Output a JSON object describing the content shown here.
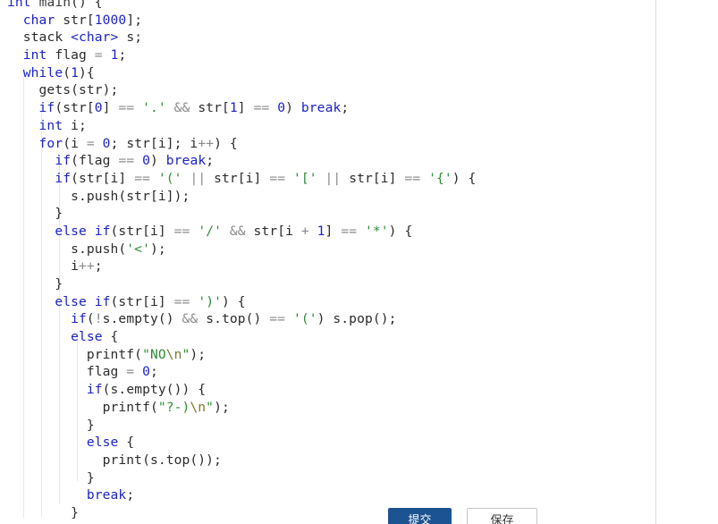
{
  "editor": {
    "language": "cpp",
    "background": "#ffffff",
    "keyword_color": "#1c22c8",
    "string_color": "#2e8b36",
    "operator_color": "#8a8a8a",
    "text_color": "#2b2b2b",
    "guide_color": "#e8e8e8",
    "lines": [
      [
        {
          "t": "int",
          "c": "kw"
        },
        {
          "t": " ",
          "c": "plain"
        },
        {
          "t": "main",
          "c": "fn"
        },
        {
          "t": "() {",
          "c": "plain"
        }
      ],
      [
        {
          "t": "  ",
          "c": "plain"
        },
        {
          "t": "char",
          "c": "kw"
        },
        {
          "t": " str[",
          "c": "plain"
        },
        {
          "t": "1000",
          "c": "num"
        },
        {
          "t": "];",
          "c": "plain"
        }
      ],
      [
        {
          "t": "  ",
          "c": "plain"
        },
        {
          "t": "stack",
          "c": "plain"
        },
        {
          "t": " ",
          "c": "plain"
        },
        {
          "t": "<char>",
          "c": "kw"
        },
        {
          "t": " s;",
          "c": "plain"
        }
      ],
      [
        {
          "t": "  ",
          "c": "plain"
        },
        {
          "t": "int",
          "c": "kw"
        },
        {
          "t": " flag ",
          "c": "plain"
        },
        {
          "t": "=",
          "c": "op"
        },
        {
          "t": " ",
          "c": "plain"
        },
        {
          "t": "1",
          "c": "num"
        },
        {
          "t": ";",
          "c": "plain"
        }
      ],
      [
        {
          "t": "  ",
          "c": "plain"
        },
        {
          "t": "while",
          "c": "kw"
        },
        {
          "t": "(",
          "c": "plain"
        },
        {
          "t": "1",
          "c": "num"
        },
        {
          "t": "){",
          "c": "plain"
        }
      ],
      [
        {
          "t": "    gets(str);",
          "c": "plain"
        }
      ],
      [
        {
          "t": "    ",
          "c": "plain"
        },
        {
          "t": "if",
          "c": "kw"
        },
        {
          "t": "(str[",
          "c": "plain"
        },
        {
          "t": "0",
          "c": "num"
        },
        {
          "t": "] ",
          "c": "plain"
        },
        {
          "t": "==",
          "c": "op"
        },
        {
          "t": " ",
          "c": "plain"
        },
        {
          "t": "'.'",
          "c": "str"
        },
        {
          "t": " ",
          "c": "plain"
        },
        {
          "t": "&&",
          "c": "op"
        },
        {
          "t": " str[",
          "c": "plain"
        },
        {
          "t": "1",
          "c": "num"
        },
        {
          "t": "] ",
          "c": "plain"
        },
        {
          "t": "==",
          "c": "op"
        },
        {
          "t": " ",
          "c": "plain"
        },
        {
          "t": "0",
          "c": "num"
        },
        {
          "t": ") ",
          "c": "plain"
        },
        {
          "t": "break",
          "c": "kw"
        },
        {
          "t": ";",
          "c": "plain"
        }
      ],
      [
        {
          "t": "    ",
          "c": "plain"
        },
        {
          "t": "int",
          "c": "kw"
        },
        {
          "t": " i;",
          "c": "plain"
        }
      ],
      [
        {
          "t": "    ",
          "c": "plain"
        },
        {
          "t": "for",
          "c": "kw"
        },
        {
          "t": "(i ",
          "c": "plain"
        },
        {
          "t": "=",
          "c": "op"
        },
        {
          "t": " ",
          "c": "plain"
        },
        {
          "t": "0",
          "c": "num"
        },
        {
          "t": "; str[i]; i",
          "c": "plain"
        },
        {
          "t": "++",
          "c": "op"
        },
        {
          "t": ") {",
          "c": "plain"
        }
      ],
      [
        {
          "t": "      ",
          "c": "plain"
        },
        {
          "t": "if",
          "c": "kw"
        },
        {
          "t": "(flag ",
          "c": "plain"
        },
        {
          "t": "==",
          "c": "op"
        },
        {
          "t": " ",
          "c": "plain"
        },
        {
          "t": "0",
          "c": "num"
        },
        {
          "t": ") ",
          "c": "plain"
        },
        {
          "t": "break",
          "c": "kw"
        },
        {
          "t": ";",
          "c": "plain"
        }
      ],
      [
        {
          "t": "      ",
          "c": "plain"
        },
        {
          "t": "if",
          "c": "kw"
        },
        {
          "t": "(str[i] ",
          "c": "plain"
        },
        {
          "t": "==",
          "c": "op"
        },
        {
          "t": " ",
          "c": "plain"
        },
        {
          "t": "'('",
          "c": "str"
        },
        {
          "t": " ",
          "c": "plain"
        },
        {
          "t": "||",
          "c": "op"
        },
        {
          "t": " str[i] ",
          "c": "plain"
        },
        {
          "t": "==",
          "c": "op"
        },
        {
          "t": " ",
          "c": "plain"
        },
        {
          "t": "'['",
          "c": "str"
        },
        {
          "t": " ",
          "c": "plain"
        },
        {
          "t": "||",
          "c": "op"
        },
        {
          "t": " str[i] ",
          "c": "plain"
        },
        {
          "t": "==",
          "c": "op"
        },
        {
          "t": " ",
          "c": "plain"
        },
        {
          "t": "'{'",
          "c": "str"
        },
        {
          "t": ") {",
          "c": "plain"
        }
      ],
      [
        {
          "t": "        s.push(str[i]);",
          "c": "plain"
        }
      ],
      [
        {
          "t": "      }",
          "c": "plain"
        }
      ],
      [
        {
          "t": "      ",
          "c": "plain"
        },
        {
          "t": "else",
          "c": "kw"
        },
        {
          "t": " ",
          "c": "plain"
        },
        {
          "t": "if",
          "c": "kw"
        },
        {
          "t": "(str[i] ",
          "c": "plain"
        },
        {
          "t": "==",
          "c": "op"
        },
        {
          "t": " ",
          "c": "plain"
        },
        {
          "t": "'/'",
          "c": "str"
        },
        {
          "t": " ",
          "c": "plain"
        },
        {
          "t": "&&",
          "c": "op"
        },
        {
          "t": " str[i ",
          "c": "plain"
        },
        {
          "t": "+",
          "c": "op"
        },
        {
          "t": " ",
          "c": "plain"
        },
        {
          "t": "1",
          "c": "num"
        },
        {
          "t": "] ",
          "c": "plain"
        },
        {
          "t": "==",
          "c": "op"
        },
        {
          "t": " ",
          "c": "plain"
        },
        {
          "t": "'*'",
          "c": "str"
        },
        {
          "t": ") {",
          "c": "plain"
        }
      ],
      [
        {
          "t": "        s.push(",
          "c": "plain"
        },
        {
          "t": "'<'",
          "c": "str"
        },
        {
          "t": ");",
          "c": "plain"
        }
      ],
      [
        {
          "t": "        i",
          "c": "plain"
        },
        {
          "t": "++",
          "c": "op"
        },
        {
          "t": ";",
          "c": "plain"
        }
      ],
      [
        {
          "t": "      }",
          "c": "plain"
        }
      ],
      [
        {
          "t": "      ",
          "c": "plain"
        },
        {
          "t": "else",
          "c": "kw"
        },
        {
          "t": " ",
          "c": "plain"
        },
        {
          "t": "if",
          "c": "kw"
        },
        {
          "t": "(str[i] ",
          "c": "plain"
        },
        {
          "t": "==",
          "c": "op"
        },
        {
          "t": " ",
          "c": "plain"
        },
        {
          "t": "')'",
          "c": "str"
        },
        {
          "t": ") {",
          "c": "plain"
        }
      ],
      [
        {
          "t": "        ",
          "c": "plain"
        },
        {
          "t": "if",
          "c": "kw"
        },
        {
          "t": "(",
          "c": "plain"
        },
        {
          "t": "!",
          "c": "op"
        },
        {
          "t": "s.empty() ",
          "c": "plain"
        },
        {
          "t": "&&",
          "c": "op"
        },
        {
          "t": " s.top() ",
          "c": "plain"
        },
        {
          "t": "==",
          "c": "op"
        },
        {
          "t": " ",
          "c": "plain"
        },
        {
          "t": "'('",
          "c": "str"
        },
        {
          "t": ") s.pop();",
          "c": "plain"
        }
      ],
      [
        {
          "t": "        ",
          "c": "plain"
        },
        {
          "t": "else",
          "c": "kw"
        },
        {
          "t": " {",
          "c": "plain"
        }
      ],
      [
        {
          "t": "          printf(",
          "c": "plain"
        },
        {
          "t": "\"NO",
          "c": "str"
        },
        {
          "t": "\\n",
          "c": "esc"
        },
        {
          "t": "\"",
          "c": "str"
        },
        {
          "t": ");",
          "c": "plain"
        }
      ],
      [
        {
          "t": "          flag ",
          "c": "plain"
        },
        {
          "t": "=",
          "c": "op"
        },
        {
          "t": " ",
          "c": "plain"
        },
        {
          "t": "0",
          "c": "num"
        },
        {
          "t": ";",
          "c": "plain"
        }
      ],
      [
        {
          "t": "          ",
          "c": "plain"
        },
        {
          "t": "if",
          "c": "kw"
        },
        {
          "t": "(s.empty()) {",
          "c": "plain"
        }
      ],
      [
        {
          "t": "            printf(",
          "c": "plain"
        },
        {
          "t": "\"?-)",
          "c": "str"
        },
        {
          "t": "\\n",
          "c": "esc"
        },
        {
          "t": "\"",
          "c": "str"
        },
        {
          "t": ");",
          "c": "plain"
        }
      ],
      [
        {
          "t": "          }",
          "c": "plain"
        }
      ],
      [
        {
          "t": "          ",
          "c": "plain"
        },
        {
          "t": "else",
          "c": "kw"
        },
        {
          "t": " {",
          "c": "plain"
        }
      ],
      [
        {
          "t": "            print(s.top());",
          "c": "plain"
        }
      ],
      [
        {
          "t": "          }",
          "c": "plain"
        }
      ],
      [
        {
          "t": "          ",
          "c": "plain"
        },
        {
          "t": "break",
          "c": "kw"
        },
        {
          "t": ";",
          "c": "plain"
        }
      ],
      [
        {
          "t": "        }",
          "c": "plain"
        }
      ]
    ]
  },
  "action_bar": {
    "primary_label": "提交",
    "secondary_label": "保存",
    "primary_color": "#1c5392",
    "secondary_border": "#c6c6c6"
  }
}
